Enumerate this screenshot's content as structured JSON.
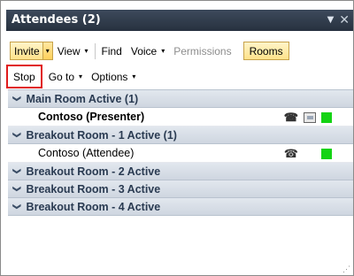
{
  "window": {
    "title": "Attendees (2)",
    "menu_glyph": "▼",
    "close_glyph": "✕"
  },
  "toolbar1": {
    "invite": "Invite",
    "view": "View",
    "find": "Find",
    "voice": "Voice",
    "permissions": "Permissions",
    "rooms": "Rooms"
  },
  "toolbar2": {
    "stop": "Stop",
    "goto": "Go to",
    "options": "Options"
  },
  "groups": [
    {
      "label": "Main Room Active (1)"
    },
    {
      "label": "Breakout Room - 1 Active (1)"
    },
    {
      "label": "Breakout Room - 2 Active"
    },
    {
      "label": "Breakout Room - 3 Active"
    },
    {
      "label": "Breakout Room - 4 Active"
    }
  ],
  "attendees": [
    {
      "name": "Contoso (Presenter)",
      "status_color": "#14d314"
    },
    {
      "name": "Contoso (Attendee)",
      "status_color": "#14d314"
    }
  ],
  "icons": {
    "caret": "▾",
    "chevron": "❯",
    "phone": "☎",
    "resize": "⋰"
  },
  "colors": {
    "titlebar": "#27313f",
    "group_header": "#cfd6e0",
    "highlight": "#e01b1b",
    "button_active": "#ffe28a"
  }
}
